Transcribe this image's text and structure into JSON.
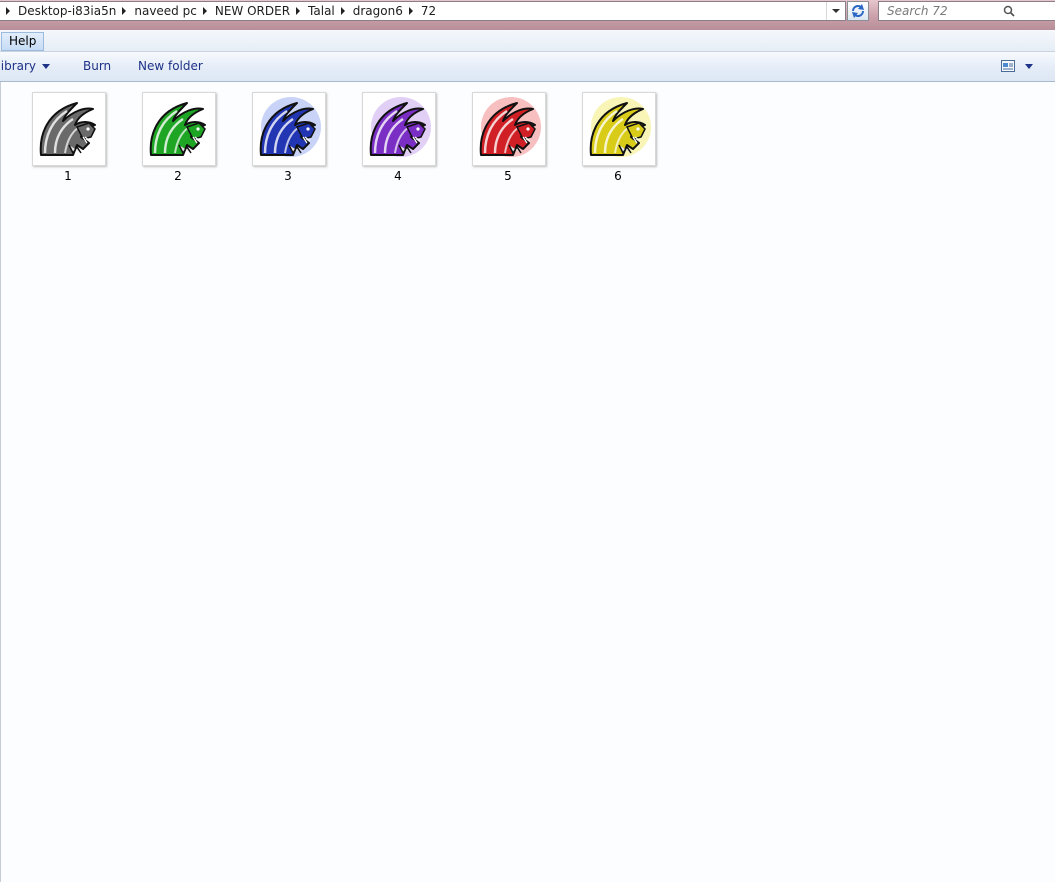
{
  "address_bar": {
    "crumbs": [
      "Desktop-i83ia5n",
      "naveed pc",
      "NEW ORDER",
      "Talal",
      "dragon6",
      "72"
    ]
  },
  "search": {
    "placeholder": "Search 72"
  },
  "menu": {
    "help": "Help"
  },
  "toolbar": {
    "library_label": "n library",
    "burn_label": "Burn",
    "new_folder_label": "New folder"
  },
  "files": [
    {
      "name": "1",
      "color": "#6a6a6a",
      "glow": "none"
    },
    {
      "name": "2",
      "color": "#1fa524",
      "glow": "none"
    },
    {
      "name": "3",
      "color": "#2236b4",
      "glow": "#9aaef0"
    },
    {
      "name": "4",
      "color": "#7a2ec4",
      "glow": "#c9a8ee"
    },
    {
      "name": "5",
      "color": "#d01f25",
      "glow": "#f08a8a"
    },
    {
      "name": "6",
      "color": "#d8cc18",
      "glow": "#f2ec7a"
    }
  ]
}
